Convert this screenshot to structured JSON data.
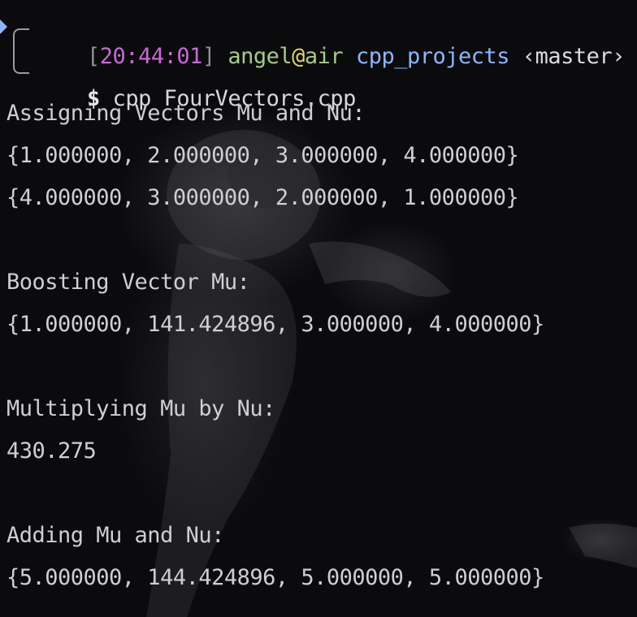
{
  "prompt": {
    "bracket_open": "[",
    "time": "20:44:01",
    "bracket_close": "]",
    "user": "angel",
    "at": "@",
    "host": "air",
    "directory": "cpp_projects",
    "branch": "‹master›",
    "dollar": "$",
    "command": "cpp FourVectors.cpp"
  },
  "output": [
    "Assigning Vectors Mu and Nu:",
    "{1.000000, 2.000000, 3.000000, 4.000000}",
    "{4.000000, 3.000000, 2.000000, 1.000000}",
    "",
    "Boosting Vector Mu:",
    "{1.000000, 141.424896, 3.000000, 4.000000}",
    "",
    "Multiplying Mu by Nu:",
    "430.275",
    "",
    "Adding Mu and Nu:",
    "{5.000000, 144.424896, 5.000000, 5.000000}"
  ],
  "colors": {
    "background": "#0b0b0d",
    "time": "#c66ad3",
    "user_host": "#a8c98a",
    "directory": "#8fb4ff",
    "output_text": "#cfcfd2"
  },
  "icons": {
    "prompt_marker": "caret-right-icon",
    "prompt_gutter": "prompt-bracket-icon"
  }
}
